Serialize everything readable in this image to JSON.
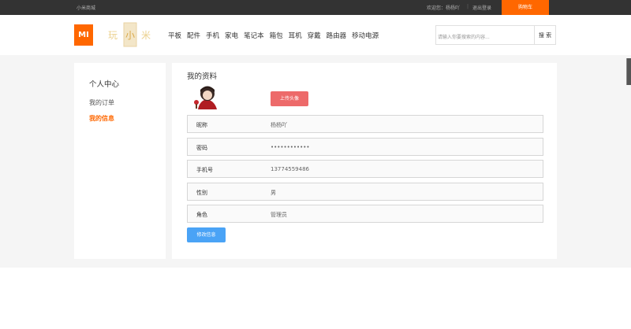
{
  "topbar": {
    "site_name": "小米商城",
    "welcome": "欢迎您：杨杨吖",
    "separator": "|",
    "logout": "退出登录",
    "cart": "购物车"
  },
  "header": {
    "logo_text": "MI",
    "brand_text": "玩小米",
    "nav": [
      "平板",
      "配件",
      "手机",
      "家电",
      "笔记本",
      "箱包",
      "耳机",
      "穿戴",
      "路由器",
      "移动电源"
    ],
    "search_placeholder": "请输入你要搜索的内容...",
    "search_button": "搜 索"
  },
  "sidebar": {
    "title": "个人中心",
    "items": [
      "我的订单",
      "我的信息"
    ]
  },
  "profile": {
    "heading": "我的资料",
    "upload_button": "上传头像",
    "fields": [
      {
        "label": "昵称",
        "value": "杨杨吖"
      },
      {
        "label": "密码",
        "value": "••••••••••••"
      },
      {
        "label": "手机号",
        "value": "13774559486"
      },
      {
        "label": "性别",
        "value": "男"
      },
      {
        "label": "角色",
        "value": "管理员"
      }
    ],
    "edit_button": "修改信息"
  },
  "colors": {
    "accent": "#ff6700",
    "upload": "#ed6a6a",
    "edit": "#4aa3f6"
  }
}
